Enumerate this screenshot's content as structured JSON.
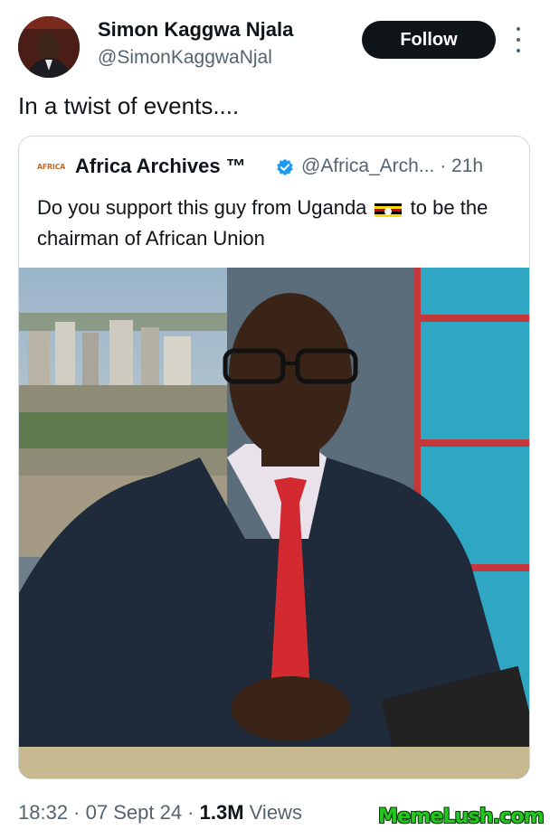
{
  "author": {
    "name": "Simon Kaggwa Njala",
    "handle": "@SimonKaggwaNjal",
    "avatar_icon": "avatar-photo"
  },
  "follow_label": "Follow",
  "more_icon": "more-vertical-icon",
  "tweet_text": "In a twist of events....",
  "quote": {
    "logo_text": "AFRICA",
    "name": "Africa Archives ™",
    "verified_icon": "verified-badge-icon",
    "handle": "@Africa_Arch...",
    "time_sep": " · ",
    "time": "21h",
    "text_before_flag": "Do you support this guy from Uganda",
    "flag_icon": "uganda-flag-icon",
    "text_after_flag": "to be the chairman of African Union"
  },
  "meta": {
    "time": "18:32",
    "sep1": " · ",
    "date": "07 Sept 24",
    "sep2": " · ",
    "views_count": "1.3M",
    "views_label": " Views"
  },
  "watermark": "MemeLush.com",
  "colors": {
    "text_primary": "#0f1419",
    "text_secondary": "#536471",
    "follow_bg": "#0f1419",
    "verified": "#1d9bf0",
    "watermark": "#24c71f"
  }
}
